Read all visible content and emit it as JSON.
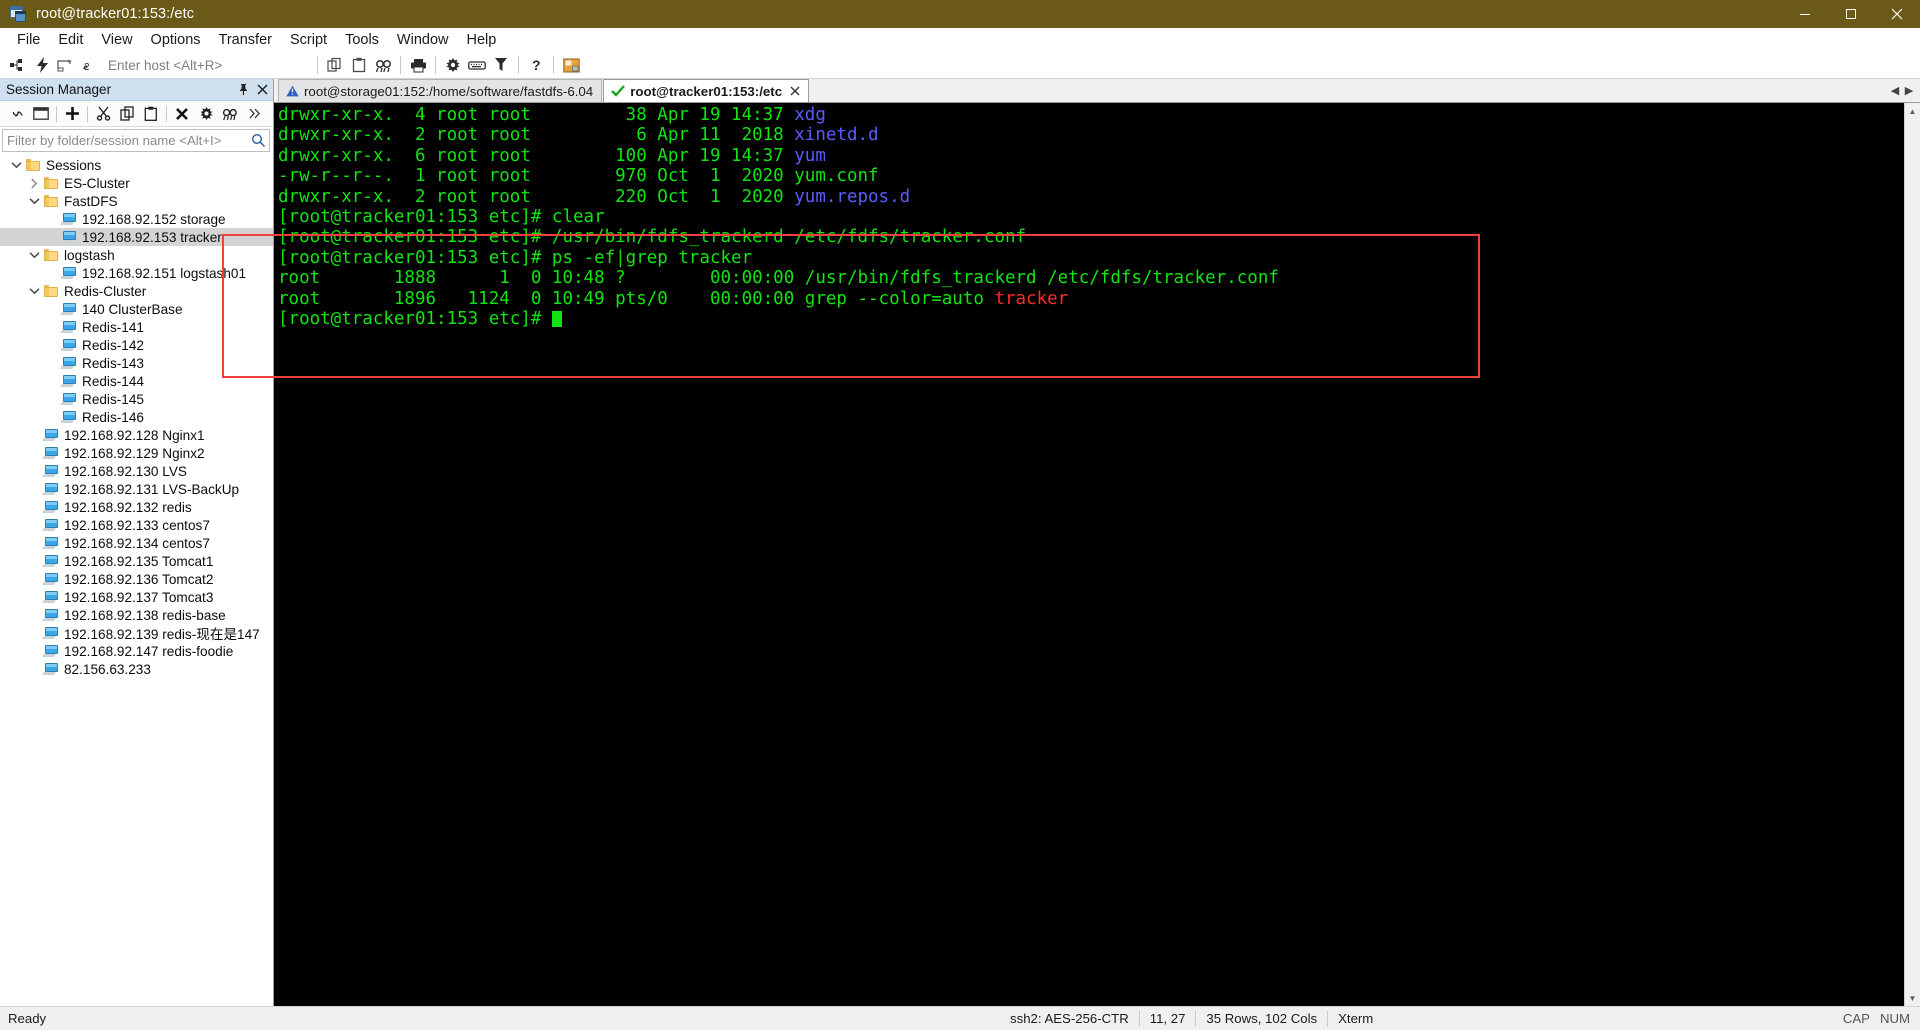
{
  "window": {
    "title": "root@tracker01:153:/etc",
    "icon": "securecrt-icon",
    "minimize": "minimize-button",
    "maximize": "maximize-button",
    "close": "close-button"
  },
  "menu": {
    "items": [
      "File",
      "Edit",
      "View",
      "Options",
      "Transfer",
      "Script",
      "Tools",
      "Window",
      "Help"
    ]
  },
  "toolbar": {
    "host_placeholder": "Enter host <Alt+R>",
    "buttons": [
      {
        "name": "connect-icon",
        "title": "Connect"
      },
      {
        "name": "quick-connect-icon",
        "title": "Quick Connect"
      },
      {
        "name": "connect-in-tab-icon",
        "title": "Connect in Tab"
      },
      {
        "name": "reconnect-icon",
        "title": "Reconnect"
      },
      {
        "name": "copy-icon",
        "title": "Copy"
      },
      {
        "name": "paste-icon",
        "title": "Paste"
      },
      {
        "name": "find-icon",
        "title": "Find"
      },
      {
        "name": "print-icon",
        "title": "Print"
      },
      {
        "name": "gear-icon",
        "title": "Session Options"
      },
      {
        "name": "keyboard-icon",
        "title": "Keymap Editor"
      },
      {
        "name": "filter-icon",
        "title": "Line Filter"
      },
      {
        "name": "help-icon",
        "title": "Help"
      },
      {
        "name": "image-icon",
        "title": "Transfer"
      }
    ]
  },
  "session_manager": {
    "title": "Session Manager",
    "pin": "pin-icon",
    "close": "close-icon",
    "toolbar": [
      {
        "name": "link-icon"
      },
      {
        "name": "new-window-icon"
      },
      {
        "name": "add-icon"
      },
      {
        "name": "cut-icon"
      },
      {
        "name": "copy-icon"
      },
      {
        "name": "paste-icon"
      },
      {
        "name": "delete-icon"
      },
      {
        "name": "properties-icon"
      },
      {
        "name": "find-icon"
      },
      {
        "name": "overflow-icon"
      }
    ],
    "filter_placeholder": "Filter by folder/session name <Alt+I>",
    "filter_value": "",
    "tree": [
      {
        "label": "Sessions",
        "depth": 0,
        "type": "folder",
        "expanded": true,
        "selected": false
      },
      {
        "label": "ES-Cluster",
        "depth": 1,
        "type": "folder",
        "expanded": false,
        "selected": false
      },
      {
        "label": "FastDFS",
        "depth": 1,
        "type": "folder",
        "expanded": true,
        "selected": false
      },
      {
        "label": "192.168.92.152 storage",
        "depth": 2,
        "type": "session",
        "expanded": null,
        "selected": false
      },
      {
        "label": "192.168.92.153 tracker",
        "depth": 2,
        "type": "session",
        "expanded": null,
        "selected": true
      },
      {
        "label": "logstash",
        "depth": 1,
        "type": "folder",
        "expanded": true,
        "selected": false
      },
      {
        "label": "192.168.92.151 logstash01",
        "depth": 2,
        "type": "session",
        "expanded": null,
        "selected": false
      },
      {
        "label": "Redis-Cluster",
        "depth": 1,
        "type": "folder",
        "expanded": true,
        "selected": false
      },
      {
        "label": "140 ClusterBase",
        "depth": 2,
        "type": "session",
        "expanded": null,
        "selected": false
      },
      {
        "label": "Redis-141",
        "depth": 2,
        "type": "session",
        "expanded": null,
        "selected": false
      },
      {
        "label": "Redis-142",
        "depth": 2,
        "type": "session",
        "expanded": null,
        "selected": false
      },
      {
        "label": "Redis-143",
        "depth": 2,
        "type": "session",
        "expanded": null,
        "selected": false
      },
      {
        "label": "Redis-144",
        "depth": 2,
        "type": "session",
        "expanded": null,
        "selected": false
      },
      {
        "label": "Redis-145",
        "depth": 2,
        "type": "session",
        "expanded": null,
        "selected": false
      },
      {
        "label": "Redis-146",
        "depth": 2,
        "type": "session",
        "expanded": null,
        "selected": false
      },
      {
        "label": "192.168.92.128 Nginx1",
        "depth": 1,
        "type": "session",
        "expanded": null,
        "selected": false
      },
      {
        "label": "192.168.92.129 Nginx2",
        "depth": 1,
        "type": "session",
        "expanded": null,
        "selected": false
      },
      {
        "label": "192.168.92.130 LVS",
        "depth": 1,
        "type": "session",
        "expanded": null,
        "selected": false
      },
      {
        "label": "192.168.92.131 LVS-BackUp",
        "depth": 1,
        "type": "session",
        "expanded": null,
        "selected": false
      },
      {
        "label": "192.168.92.132 redis",
        "depth": 1,
        "type": "session",
        "expanded": null,
        "selected": false
      },
      {
        "label": "192.168.92.133 centos7",
        "depth": 1,
        "type": "session",
        "expanded": null,
        "selected": false
      },
      {
        "label": "192.168.92.134 centos7",
        "depth": 1,
        "type": "session",
        "expanded": null,
        "selected": false
      },
      {
        "label": "192.168.92.135 Tomcat1",
        "depth": 1,
        "type": "session",
        "expanded": null,
        "selected": false
      },
      {
        "label": "192.168.92.136 Tomcat2",
        "depth": 1,
        "type": "session",
        "expanded": null,
        "selected": false
      },
      {
        "label": "192.168.92.137 Tomcat3",
        "depth": 1,
        "type": "session",
        "expanded": null,
        "selected": false
      },
      {
        "label": "192.168.92.138 redis-base",
        "depth": 1,
        "type": "session",
        "expanded": null,
        "selected": false
      },
      {
        "label": "192.168.92.139 redis-现在是147",
        "depth": 1,
        "type": "session",
        "expanded": null,
        "selected": false
      },
      {
        "label": "192.168.92.147 redis-foodie",
        "depth": 1,
        "type": "session",
        "expanded": null,
        "selected": false
      },
      {
        "label": "82.156.63.233",
        "depth": 1,
        "type": "session",
        "expanded": null,
        "selected": false
      }
    ]
  },
  "tabs": [
    {
      "label": "root@storage01:152:/home/software/fastdfs-6.04",
      "status": "warning",
      "active": false,
      "closable": false
    },
    {
      "label": "root@tracker01:153:/etc",
      "status": "ok",
      "active": true,
      "closable": true
    }
  ],
  "terminal": {
    "fg_color": "#13e313",
    "bg_color": "#000000",
    "dir_color": "#5b5bff",
    "match_color": "#ff2b2b",
    "lines": [
      [
        {
          "t": "drwxr-xr-x.  4 root root         38 Apr 19 14:37 ",
          "c": "grn"
        },
        {
          "t": "xdg",
          "c": "blue"
        }
      ],
      [
        {
          "t": "drwxr-xr-x.  2 root root          6 Apr 11  2018 ",
          "c": "grn"
        },
        {
          "t": "xinetd.d",
          "c": "blue"
        }
      ],
      [
        {
          "t": "drwxr-xr-x.  6 root root        100 Apr 19 14:37 ",
          "c": "grn"
        },
        {
          "t": "yum",
          "c": "blue"
        }
      ],
      [
        {
          "t": "-rw-r--r--.  1 root root        970 Oct  1  2020 yum.conf",
          "c": "grn"
        }
      ],
      [
        {
          "t": "drwxr-xr-x.  2 root root        220 Oct  1  2020 ",
          "c": "grn"
        },
        {
          "t": "yum.repos.d",
          "c": "blue"
        }
      ],
      [
        {
          "t": "[root@tracker01:153 etc]# clear",
          "c": "grn"
        }
      ],
      [
        {
          "t": "[root@tracker01:153 etc]# /usr/bin/fdfs_trackerd /etc/fdfs/tracker.conf",
          "c": "grn"
        }
      ],
      [
        {
          "t": "[root@tracker01:153 etc]# ps -ef|grep tracker",
          "c": "grn"
        }
      ],
      [
        {
          "t": "root       1888      1  0 10:48 ?        00:00:00 /usr/bin/fdfs_trackerd /etc/fdfs/tracker.conf",
          "c": "grn"
        }
      ],
      [
        {
          "t": "root       1896   1124  0 10:49 pts/0    00:00:00 grep --color=auto ",
          "c": "grn"
        },
        {
          "t": "tracker",
          "c": "red"
        }
      ],
      [
        {
          "t": "[root@tracker01:153 etc]# ",
          "c": "grn"
        },
        {
          "t": "█",
          "c": "cursor"
        }
      ]
    ],
    "highlight": {
      "color": "#f0403c",
      "label": "ps-output-highlight"
    }
  },
  "statusbar": {
    "ready": "Ready",
    "cipher": "ssh2: AES-256-CTR",
    "position": "11,  27",
    "size": "35 Rows, 102 Cols",
    "emulation": "Xterm",
    "cap": "CAP",
    "num": "NUM"
  }
}
